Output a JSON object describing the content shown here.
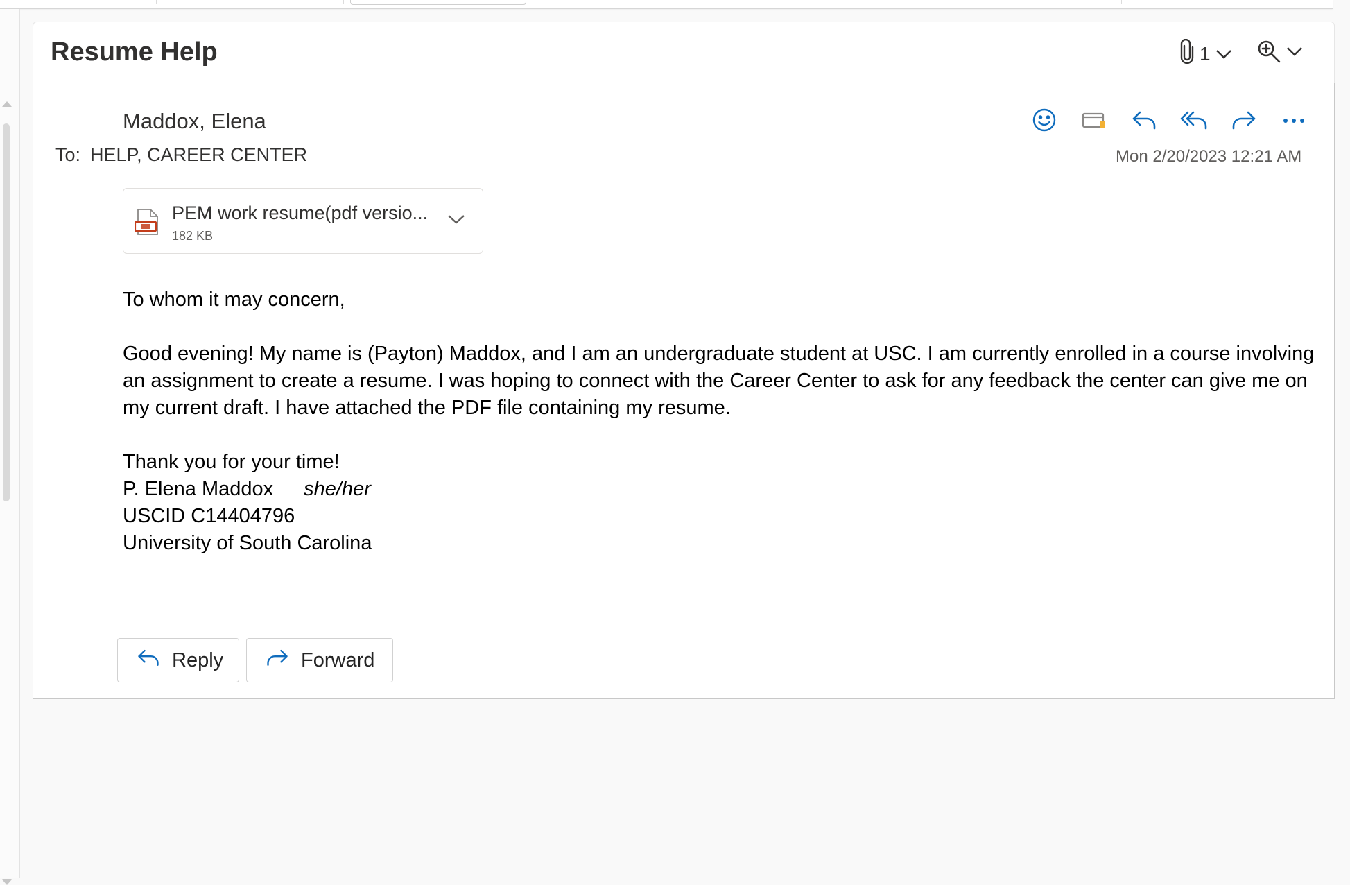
{
  "colors": {
    "accent": "#0f6cbd",
    "pdf_red": "#c43e1c",
    "text": "#242424",
    "muted": "#605e5c"
  },
  "subject": {
    "title": "Resume Help"
  },
  "header_controls": {
    "attachment_count": "1"
  },
  "message": {
    "sender": "Maddox, Elena",
    "to_label": "To:",
    "to_value": "HELP, CAREER CENTER",
    "timestamp": "Mon 2/20/2023 12:21 AM",
    "toolbar_icons": [
      "smiley-icon",
      "mail-tag-icon",
      "reply-icon",
      "reply-all-icon",
      "forward-icon",
      "more-icon"
    ]
  },
  "attachment": {
    "name": "PEM work resume(pdf versio...",
    "size": "182 KB",
    "icon": "pdf-file-icon"
  },
  "body": {
    "greeting": "To whom it may concern,",
    "paragraph": "Good evening! My name is (Payton) Maddox, and I am an undergraduate student at USC. I am currently enrolled in a course involving an assignment to create a resume. I was hoping to connect with the Career Center to ask for any feedback the center can give me on my current draft. I have attached the PDF file containing my resume.",
    "closing": "Thank you for your time!",
    "signature_name": "P. Elena Maddox",
    "signature_pronouns": "she/her",
    "signature_id": "USCID C14404796",
    "signature_org": "University of South Carolina"
  },
  "actions": {
    "reply_label": "Reply",
    "forward_label": "Forward"
  }
}
